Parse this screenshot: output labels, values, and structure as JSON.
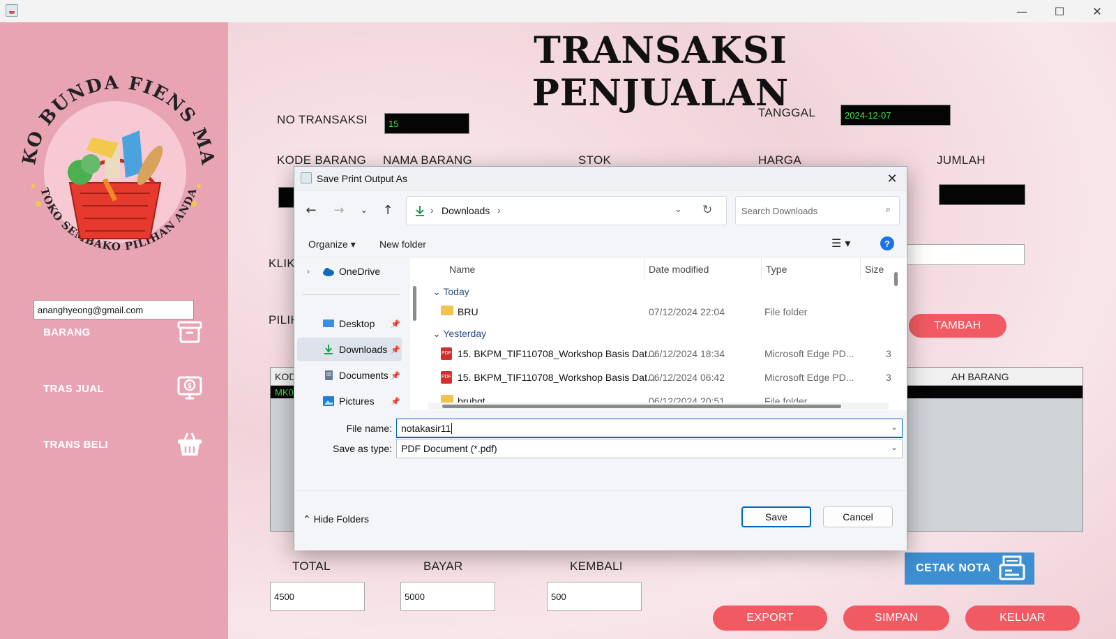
{
  "window": {
    "minimize": "—",
    "maximize": "☐",
    "close": "✕"
  },
  "sidebar": {
    "logo_text_top": "TOKO BUNDA FIENS MART",
    "logo_text_bottom": "TOKO SEMBAKO PILIHAN ANDA",
    "email": "ananghyeong@gmail.com",
    "items": [
      {
        "label": "BARANG",
        "icon": "archive-box-icon"
      },
      {
        "label": "TRAS JUAL",
        "icon": "cash-register-icon"
      },
      {
        "label": "TRANS BELI",
        "icon": "shopping-basket-icon"
      }
    ]
  },
  "main": {
    "title": "TRANSAKSI PENJUALAN",
    "no_transaksi_label": "NO TRANSAKSI",
    "no_transaksi_value": "15",
    "tanggal_label": "TANGGAL",
    "tanggal_value": "2024-12-07",
    "kode_barang_label": "KODE BARANG",
    "nama_barang_label": "NAMA BARANG",
    "stok_label": "STOK",
    "harga_label": "HARGA",
    "jumlah_label": "JUMLAH",
    "klik_label": "KLIK",
    "pilih_label": "PILIH",
    "tambah_button": "TAMBAH",
    "table_header_left": "KOD",
    "table_header_right": "AH BARANG",
    "table_row_left": "MK0",
    "total_label": "TOTAL",
    "total_value": "4500",
    "bayar_label": "BAYAR",
    "bayar_value": "5000",
    "kembali_label": "KEMBALI",
    "kembali_value": "500",
    "cetak_button": "CETAK NOTA",
    "export_button": "EXPORT",
    "simpan_button": "SIMPAN",
    "keluar_button": "KELUAR"
  },
  "dialog": {
    "title": "Save Print Output As",
    "close": "✕",
    "breadcrumb": "Downloads",
    "search_placeholder": "Search Downloads",
    "organize": "Organize",
    "new_folder": "New folder",
    "help": "?",
    "nav": [
      {
        "label": "OneDrive",
        "icon": "cloud-icon"
      },
      {
        "label": "Desktop",
        "icon": "desktop-icon"
      },
      {
        "label": "Downloads",
        "icon": "download-icon"
      },
      {
        "label": "Documents",
        "icon": "document-icon"
      },
      {
        "label": "Pictures",
        "icon": "picture-icon"
      }
    ],
    "columns": [
      "Name",
      "Date modified",
      "Type",
      "Size"
    ],
    "groups": [
      "Today",
      "Yesterday"
    ],
    "files": [
      {
        "name": "BRU",
        "date": "07/12/2024 22:04",
        "type": "File folder",
        "size": "",
        "icon": "folder-icon"
      },
      {
        "name": "15. BKPM_TIF110708_Workshop Basis Dat...",
        "date": "06/12/2024 18:34",
        "type": "Microsoft Edge PD...",
        "size": "3",
        "icon": "pdf-icon"
      },
      {
        "name": "15. BKPM_TIF110708_Workshop Basis Dat...",
        "date": "06/12/2024 06:42",
        "type": "Microsoft Edge PD...",
        "size": "3",
        "icon": "pdf-icon"
      },
      {
        "name": "bruhgt",
        "date": "06/12/2024 20:51",
        "type": "File folder",
        "size": "",
        "icon": "folder-icon"
      }
    ],
    "file_name_label": "File name:",
    "file_name_value": "notakasir11",
    "save_type_label": "Save as type:",
    "save_type_value": "PDF Document (*.pdf)",
    "hide_folders": "Hide Folders",
    "save_button": "Save",
    "cancel_button": "Cancel"
  },
  "colors": {
    "sidebar": "#e8a4b3",
    "accent_red": "#f15a62",
    "accent_blue": "#3d8fd1",
    "dialog_blue": "#0067c0"
  }
}
